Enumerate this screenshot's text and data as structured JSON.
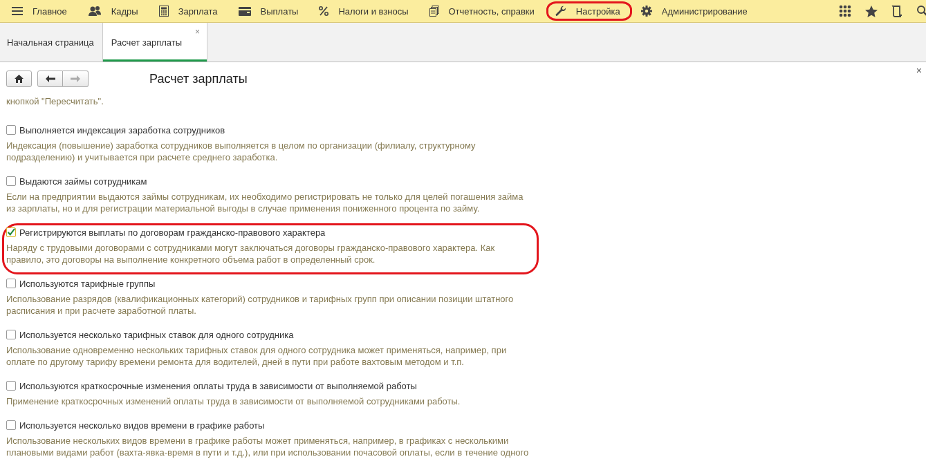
{
  "nav": [
    {
      "label": "Главное",
      "highlighted": false
    },
    {
      "label": "Кадры",
      "highlighted": false
    },
    {
      "label": "Зарплата",
      "highlighted": false
    },
    {
      "label": "Выплаты",
      "highlighted": false
    },
    {
      "label": "Налоги и взносы",
      "highlighted": false
    },
    {
      "label": "Отчетность, справки",
      "highlighted": false
    },
    {
      "label": "Настройка",
      "highlighted": true
    },
    {
      "label": "Администрирование",
      "highlighted": false
    }
  ],
  "tabs": [
    {
      "label": "Начальная страница",
      "selected": false
    },
    {
      "label": "Расчет зарплаты",
      "selected": true,
      "close": "×"
    }
  ],
  "page": {
    "title": "Расчет зарплаты",
    "close": "×",
    "intro": "кнопкой \"Пересчитать\".",
    "options": [
      {
        "label": "Выполняется индексация заработка сотрудников",
        "checked": false,
        "highlighted": false,
        "lines": [
          "Индексация (повышение) заработка сотрудников выполняется в целом по организации (филиалу, структурному",
          "подразделению) и учитывается при расчете среднего заработка."
        ]
      },
      {
        "label": "Выдаются займы сотрудникам",
        "checked": false,
        "highlighted": false,
        "lines": [
          "Если на предприятии выдаются займы сотрудникам, их необходимо регистрировать не только для целей погашения займа",
          "из зарплаты, но и для регистрации материальной выгоды в случае применения пониженного процента по займу."
        ]
      },
      {
        "label": "Регистрируются выплаты по договорам гражданско-правового характера",
        "checked": true,
        "highlighted": true,
        "lines": [
          "Наряду с трудовыми договорами с сотрудниками могут заключаться договоры гражданско-правового характера. Как",
          "правило, это договоры на выполнение конкретного объема работ в определенный срок."
        ]
      },
      {
        "label": "Используются тарифные группы",
        "checked": false,
        "highlighted": false,
        "lines": [
          "Использование разрядов (квалификационных категорий) сотрудников и тарифных групп при описании позиции штатного",
          "расписания и при расчете заработной платы."
        ]
      },
      {
        "label": "Используется несколько тарифных ставок для одного сотрудника",
        "checked": false,
        "highlighted": false,
        "lines": [
          "Использование одновременно нескольких тарифных ставок для одного сотрудника может применяться, например, при",
          "оплате по другому тарифу времени ремонта для водителей, дней в пути при работе вахтовым методом и т.п."
        ]
      },
      {
        "label": "Используются краткосрочные изменения оплаты труда в зависимости от выполняемой работы",
        "checked": false,
        "highlighted": false,
        "lines": [
          "Применение краткосрочных изменений оплаты труда в зависимости от выполняемой сотрудниками работы."
        ]
      },
      {
        "label": "Используется несколько видов времени в графике работы",
        "checked": false,
        "highlighted": false,
        "lines": [
          "Использование нескольких видов времени в графике работы может применяться, например, в графиках с несколькими",
          "плановыми видами работ (вахта-явка-время в пути и т.д.), или при использовании почасовой оплаты, если в течение одного"
        ]
      }
    ]
  }
}
